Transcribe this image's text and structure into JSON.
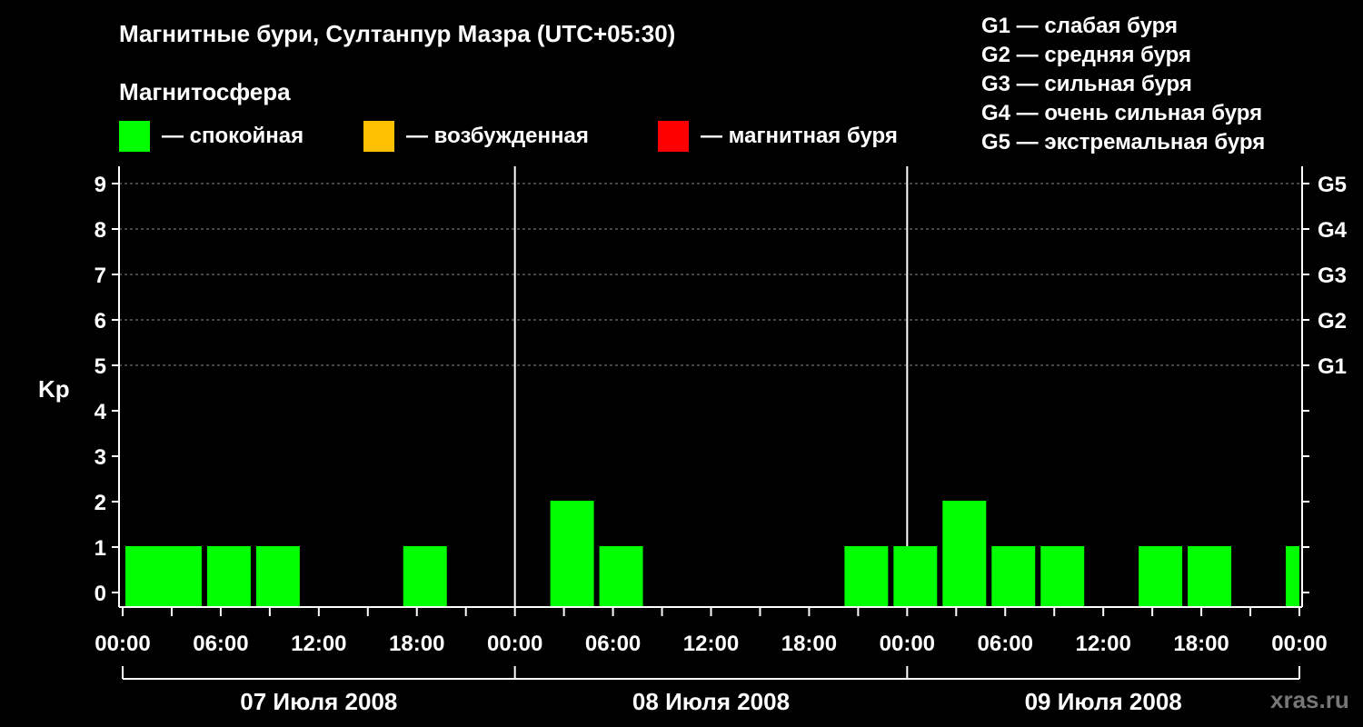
{
  "header": {
    "title": "Магнитные бури, Султанпур Мазра (UTC+05:30)",
    "subtitle": "Магнитосфера"
  },
  "legend": {
    "states": [
      {
        "label": "— спокойная",
        "color": "#00ff00"
      },
      {
        "label": "— возбужденная",
        "color": "#ffc000"
      },
      {
        "label": "— магнитная буря",
        "color": "#ff0000"
      }
    ],
    "g_levels": [
      "G1 — слабая буря",
      "G2 — средняя буря",
      "G3 — сильная буря",
      "G4 — очень сильная буря",
      "G5 — экстремальная буря"
    ]
  },
  "watermark": "xras.ru",
  "chart_data": {
    "type": "bar",
    "ylabel": "Kp",
    "ylim": [
      0,
      9
    ],
    "yticks": [
      "0",
      "1",
      "2",
      "3",
      "4",
      "5",
      "6",
      "7",
      "8",
      "9"
    ],
    "g_axis": [
      {
        "kp": 5,
        "label": "G1"
      },
      {
        "kp": 6,
        "label": "G2"
      },
      {
        "kp": 7,
        "label": "G3"
      },
      {
        "kp": 8,
        "label": "G4"
      },
      {
        "kp": 9,
        "label": "G5"
      }
    ],
    "xticks": [
      "00:00",
      "06:00",
      "12:00",
      "18:00",
      "00:00",
      "06:00",
      "12:00",
      "18:00",
      "00:00",
      "06:00",
      "12:00",
      "18:00",
      "00:00"
    ],
    "days": [
      "07 Июля 2008",
      "08 Июля 2008",
      "09 Июля 2008"
    ],
    "grid": true,
    "bars": [
      {
        "start": "2008-07-07 00:00",
        "kp": 1,
        "state": "спокойная"
      },
      {
        "start": "2008-07-07 02:00",
        "kp": 1,
        "state": "спокойная"
      },
      {
        "start": "2008-07-07 05:00",
        "kp": 1,
        "state": "спокойная"
      },
      {
        "start": "2008-07-07 08:00",
        "kp": 1,
        "state": "спокойная"
      },
      {
        "start": "2008-07-07 17:00",
        "kp": 1,
        "state": "спокойная"
      },
      {
        "start": "2008-07-08 02:00",
        "kp": 2,
        "state": "спокойная"
      },
      {
        "start": "2008-07-08 05:00",
        "kp": 1,
        "state": "спокойная"
      },
      {
        "start": "2008-07-08 20:00",
        "kp": 1,
        "state": "спокойная"
      },
      {
        "start": "2008-07-08 23:00",
        "kp": 1,
        "state": "спокойная"
      },
      {
        "start": "2008-07-09 02:00",
        "kp": 2,
        "state": "спокойная"
      },
      {
        "start": "2008-07-09 05:00",
        "kp": 1,
        "state": "спокойная"
      },
      {
        "start": "2008-07-09 08:00",
        "kp": 1,
        "state": "спокойная"
      },
      {
        "start": "2008-07-09 14:00",
        "kp": 1,
        "state": "спокойная"
      },
      {
        "start": "2008-07-09 17:00",
        "kp": 1,
        "state": "спокойная"
      },
      {
        "start": "2008-07-09 23:00",
        "kp": 1,
        "state": "спокойная"
      }
    ]
  }
}
